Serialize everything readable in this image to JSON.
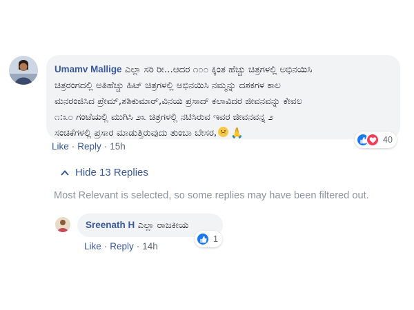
{
  "comment": {
    "author": "Umamv Mallige",
    "text_lines": [
      "ಎಲ್ಲಾ ಸರಿ ರೀ...ಆದರ ೧೦೦ ಕ್ಕಿಂತ ಹೆಚ್ಚು ಚಿತ್ರಗಳಲ್ಲಿ ಅಭಿನಯಿಸಿ",
      "ಚಿತ್ರರಂಗದಲ್ಲಿ ಅತಿಹೆಚ್ಚು ಹಿಟ್ ಚಿತ್ರಗಳಲ್ಲಿ ಅಭಿನಯಿಸಿ ನಮ್ಮನ್ನು ದಶಕಗಳ ಕಾಲ",
      "ಮನರಂಜಿಸಿದ ಪ್ರೇಮ್,ಶಶಿಕುಮಾರ್,ವಿನಯ ಪ್ರಸಾದ್ ಕಲಾವಿದರ ಜೀವನವನ್ನು ಕೇವಲ",
      "೧:೩೦ ಗಂಟೆಯಲ್ಲಿ ಮುಗಿಸಿ ೨೩ ಚಿತ್ರಗಳಲ್ಲಿ ನಟಿಸಿರುವ ಇವರ ಜೀವನವನ್ನ ೨",
      "ಸಂಚಿಕೆಗಳಲ್ಲಿ ಪ್ರಸಾರ ಮಾಡುತ್ತಿರುವುದು ತುಂಬಾ ಬೇಸರ,"
    ],
    "emojis": [
      "sad-face",
      "folded-hands"
    ],
    "actions": {
      "like": "Like",
      "reply": "Reply",
      "time": "15h"
    },
    "reaction_count": "40",
    "reaction_types": [
      "like",
      "love"
    ]
  },
  "replies_toggle": "Hide 13 Replies",
  "filter_note": "Most Relevant is selected, so some replies may have been filtered out.",
  "reply": {
    "author": "Sreenath H",
    "text": "ಎಲ್ಲಾ ರಾಜಕೀಯ",
    "actions": {
      "like": "Like",
      "reply": "Reply",
      "time": "14h"
    },
    "reaction_count": "1",
    "reaction_types": [
      "like"
    ]
  },
  "colors": {
    "link": "#385898",
    "bubble": "#f2f3f5",
    "meta": "#606770",
    "note": "#8d949e",
    "like": "#1877f2",
    "love": "#f33e58"
  }
}
